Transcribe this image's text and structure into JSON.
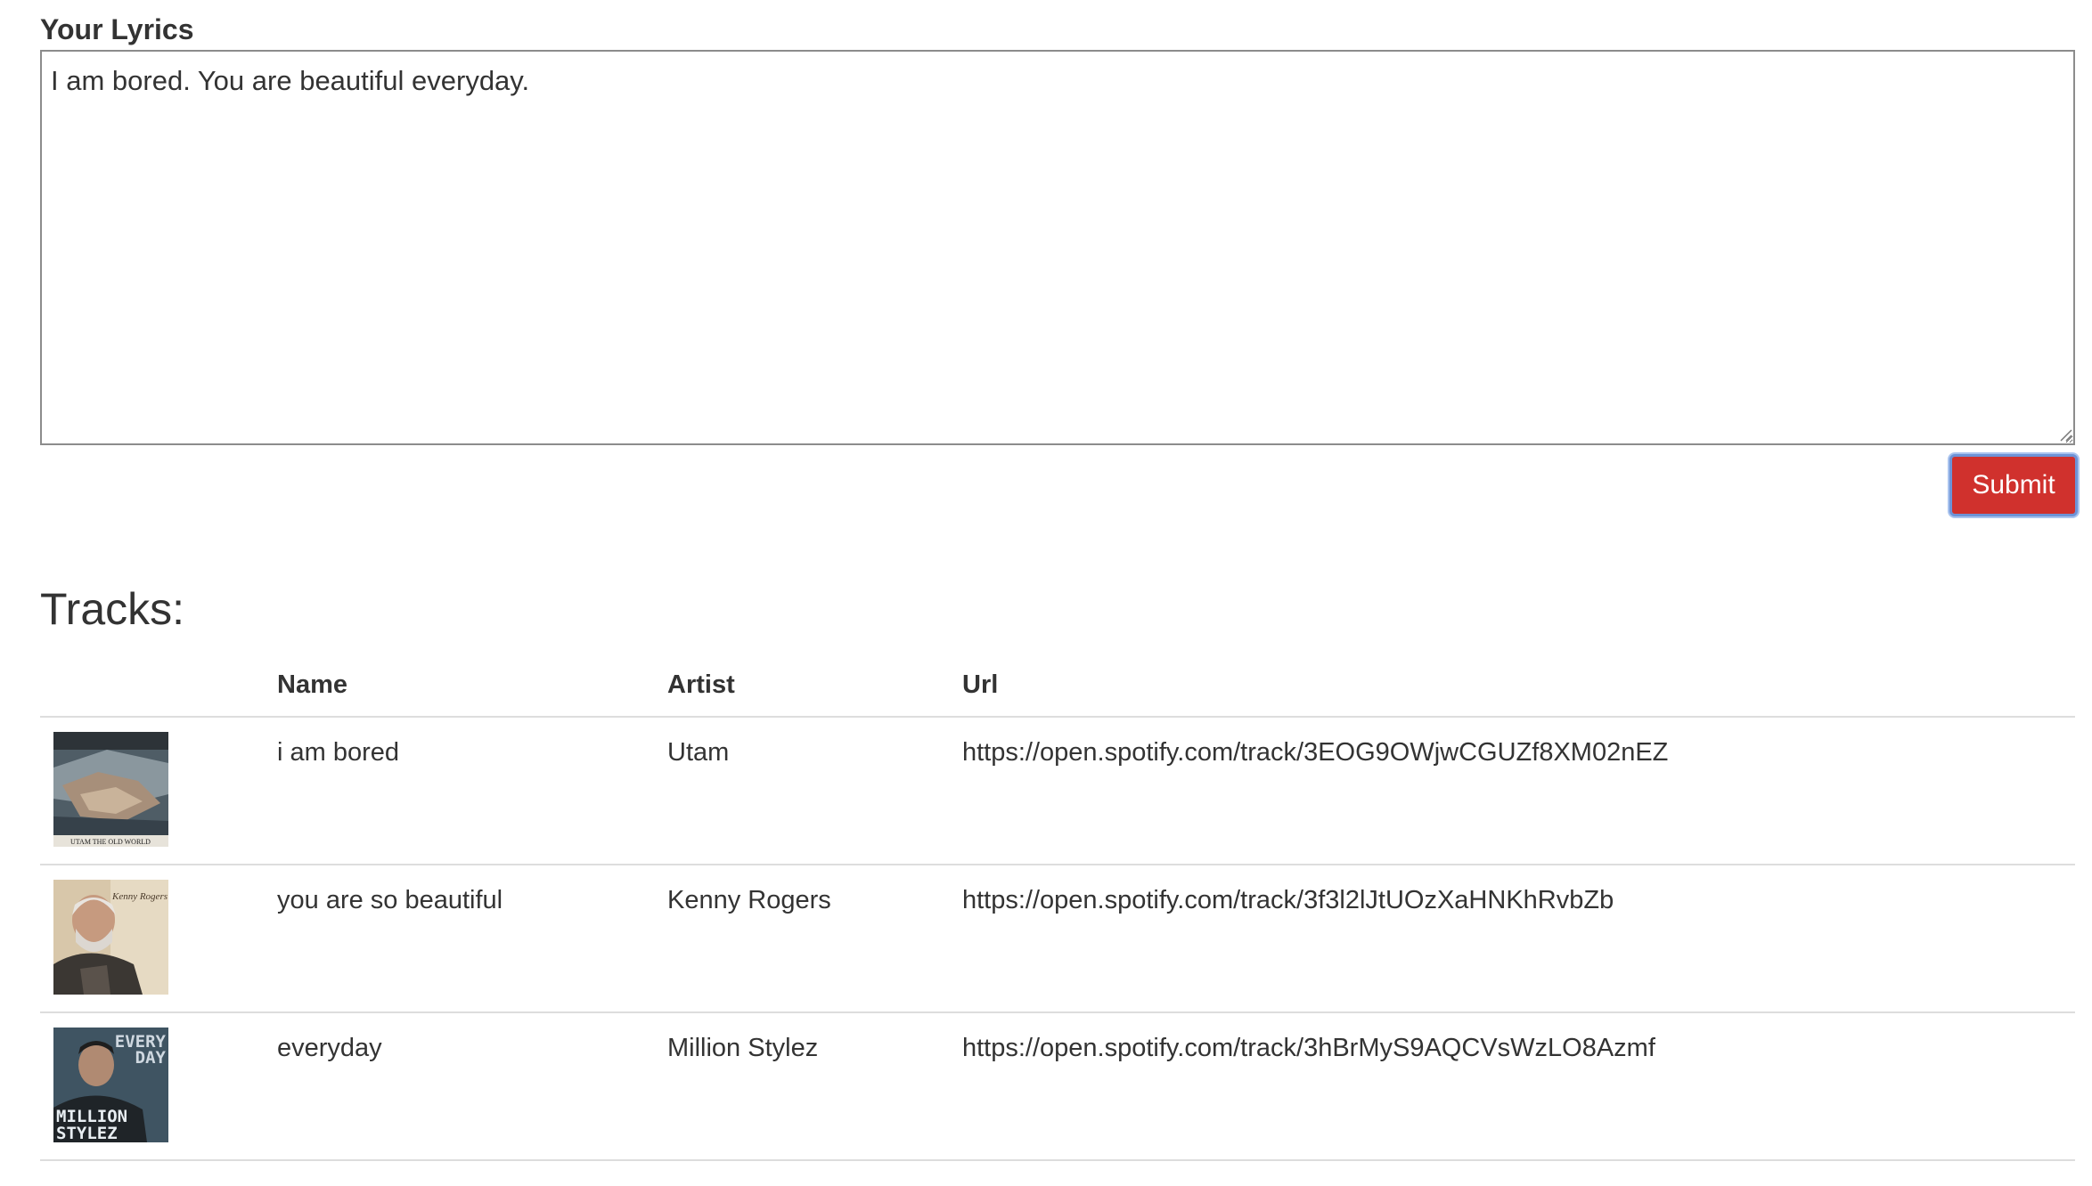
{
  "form": {
    "lyrics_label": "Your Lyrics",
    "lyrics_value": "I am bored. You are beautiful everyday.",
    "submit_label": "Submit"
  },
  "tracks": {
    "title": "Tracks:",
    "columns": {
      "cover": "",
      "name": "Name",
      "artist": "Artist",
      "url": "Url"
    },
    "rows": [
      {
        "name": "i am bored",
        "artist": "Utam",
        "url": "https://open.spotify.com/track/3EOG9OWjwCGUZf8XM02nEZ",
        "cover_text": "UTAM THE OLD WORLD"
      },
      {
        "name": "you are so beautiful",
        "artist": "Kenny Rogers",
        "url": "https://open.spotify.com/track/3f3l2lJtUOzXaHNKhRvbZb",
        "cover_text": "Kenny Rogers"
      },
      {
        "name": "everyday",
        "artist": "Million Stylez",
        "url": "https://open.spotify.com/track/3hBrMyS9AQCVsWzLO8Azmf",
        "cover_text": "EVERY DAY MILLION STYLEZ"
      }
    ]
  },
  "colors": {
    "submit_bg": "#d0312d",
    "link": "#2a6fb5",
    "divider": "#dddddd"
  }
}
